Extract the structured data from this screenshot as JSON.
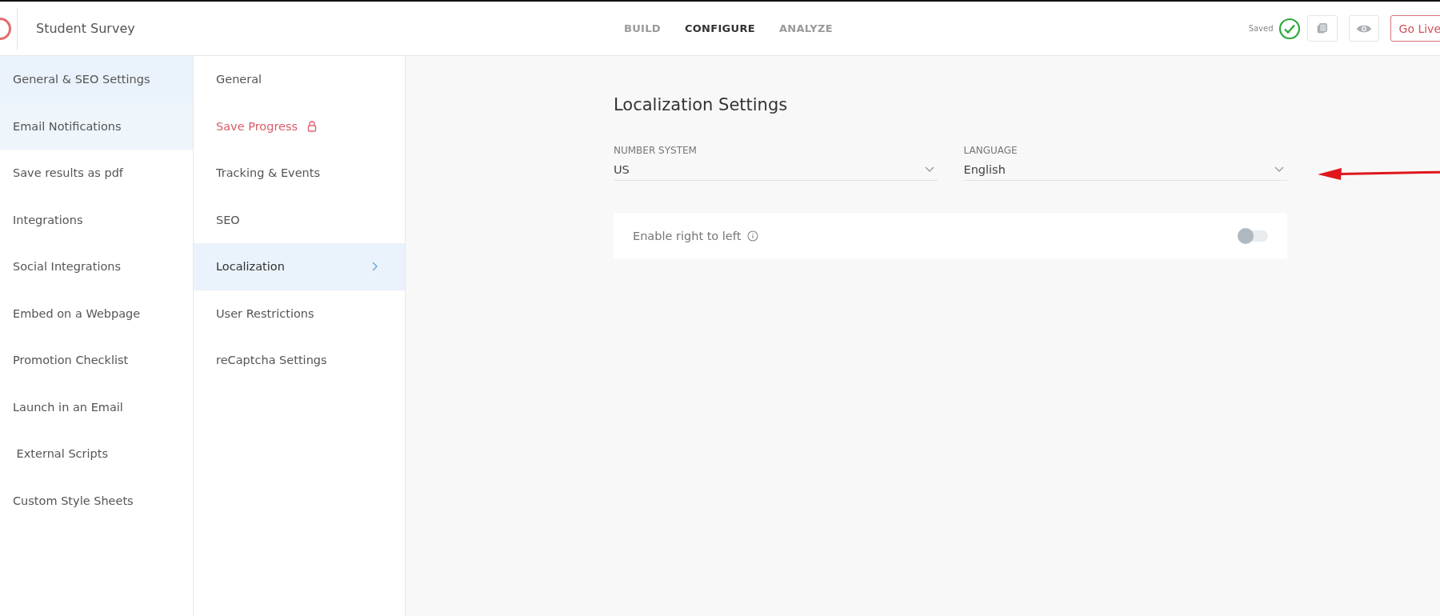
{
  "header": {
    "title": "Student Survey",
    "tabs": [
      {
        "label": "BUILD",
        "selected": false
      },
      {
        "label": "CONFIGURE",
        "selected": true
      },
      {
        "label": "ANALYZE",
        "selected": false
      }
    ],
    "status": "Saved",
    "go_live": "Go Live"
  },
  "sidebar": {
    "items": [
      {
        "label": "General & SEO Settings",
        "selected": true,
        "hovered": false
      },
      {
        "label": "Email Notifications",
        "selected": false,
        "hovered": true
      },
      {
        "label": "Save results as pdf",
        "selected": false,
        "hovered": false
      },
      {
        "label": "Integrations",
        "selected": false,
        "hovered": false
      },
      {
        "label": "Social Integrations",
        "selected": false,
        "hovered": false
      },
      {
        "label": "Embed on a Webpage",
        "selected": false,
        "hovered": false
      },
      {
        "label": "Promotion Checklist",
        "selected": false,
        "hovered": false
      },
      {
        "label": "Launch in an Email",
        "selected": false,
        "hovered": false
      },
      {
        "label": " External Scripts",
        "selected": false,
        "hovered": false
      },
      {
        "label": "Custom Style Sheets",
        "selected": false,
        "hovered": false
      }
    ]
  },
  "submenu": {
    "items": [
      {
        "label": "General",
        "selected": false,
        "locked": false
      },
      {
        "label": "Save Progress",
        "selected": false,
        "locked": true
      },
      {
        "label": "Tracking & Events",
        "selected": false,
        "locked": false
      },
      {
        "label": "SEO",
        "selected": false,
        "locked": false
      },
      {
        "label": "Localization",
        "selected": true,
        "locked": false
      },
      {
        "label": "User Restrictions",
        "selected": false,
        "locked": false
      },
      {
        "label": "reCaptcha Settings",
        "selected": false,
        "locked": false
      }
    ]
  },
  "content": {
    "title": "Localization Settings",
    "fields": [
      {
        "label": "NUMBER SYSTEM",
        "value": "US"
      },
      {
        "label": "LANGUAGE",
        "value": "English"
      }
    ],
    "toggle": {
      "label": "Enable right to left",
      "on": false
    }
  }
}
